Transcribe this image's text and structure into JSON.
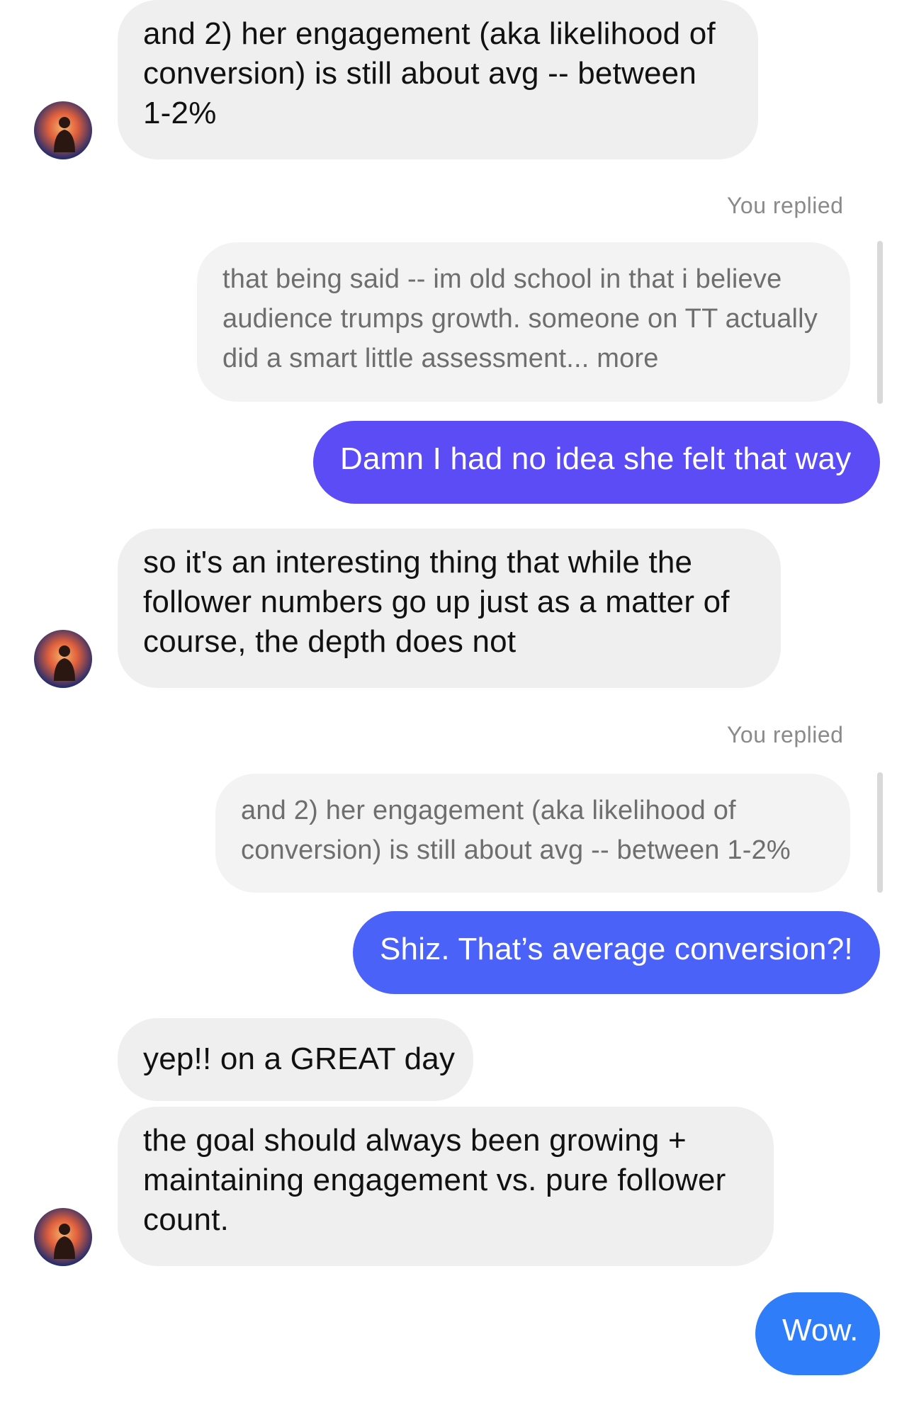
{
  "messages": [
    {
      "text": "and 2) her engagement (aka likelihood of conversion) is still about avg -- between 1-2%"
    },
    {
      "replied_label": "You replied"
    },
    {
      "quoted_text": "that being said -- im old school in that i believe audience trumps growth. someone on TT actually did a smart little assessment... more"
    },
    {
      "text": "Damn I had no idea she felt that way"
    },
    {
      "text": "so it's an interesting thing  that while the follower numbers go up just as a matter of course, the depth does not"
    },
    {
      "replied_label": "You replied"
    },
    {
      "quoted_text": "and 2) her engagement (aka likelihood of conversion) is still about avg -- between 1-2%"
    },
    {
      "text": "Shiz. That’s average conversion?!"
    },
    {
      "text": "yep!! on a GREAT day"
    },
    {
      "text": "the goal should always been growing + maintaining engagement vs. pure follower count."
    },
    {
      "text": "Wow."
    }
  ],
  "colors": {
    "outgoing_gradient": [
      "#5b4cf6",
      "#4a62f7",
      "#2f7df9"
    ],
    "incoming_bg": "#efefef",
    "quoted_bg": "#f3f3f3"
  },
  "avatar_icon": "profile-photo"
}
